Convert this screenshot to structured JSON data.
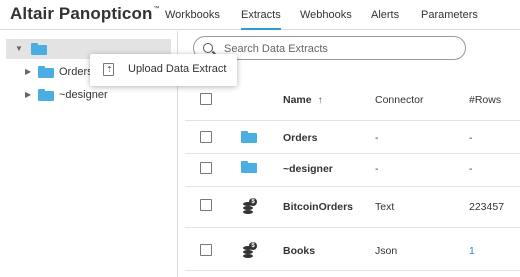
{
  "app": {
    "brand": "Altair Panopticon",
    "trademark": "™"
  },
  "tabs": [
    {
      "label": "Workbooks",
      "active": false
    },
    {
      "label": "Extracts",
      "active": true
    },
    {
      "label": "Webhooks",
      "active": false
    },
    {
      "label": "Alerts",
      "active": false
    },
    {
      "label": "Parameters",
      "active": false
    }
  ],
  "tree": {
    "root": {
      "expanded": true,
      "icon": "folder-icon"
    },
    "children": [
      {
        "label": "Orders",
        "icon": "folder-icon",
        "expanded": false
      },
      {
        "label": "~designer",
        "icon": "folder-icon",
        "expanded": false
      }
    ]
  },
  "context_menu": {
    "items": [
      {
        "label": "Upload Data Extract",
        "icon": "upload-file-icon"
      }
    ]
  },
  "search": {
    "placeholder": "Search Data Extracts",
    "value": ""
  },
  "table": {
    "columns": {
      "name": "Name",
      "sort_indicator": "↑",
      "connector": "Connector",
      "rows": "#Rows"
    },
    "rows": [
      {
        "type": "folder",
        "icon": "folder-icon",
        "name": "Orders",
        "connector": "-",
        "rows": "-"
      },
      {
        "type": "folder",
        "icon": "folder-icon",
        "name": "~designer",
        "connector": "-",
        "rows": "-"
      },
      {
        "type": "extract",
        "icon": "database-icon",
        "name": "BitcoinOrders",
        "connector": "Text",
        "rows": "223457"
      },
      {
        "type": "extract",
        "icon": "database-icon",
        "name": "Books",
        "connector": "Json",
        "rows": "1"
      }
    ]
  },
  "colors": {
    "accent": "#2e9bd6",
    "folder": "#4aaee3",
    "link": "#2e8bc9",
    "selected_row": "#e3e3e3"
  }
}
